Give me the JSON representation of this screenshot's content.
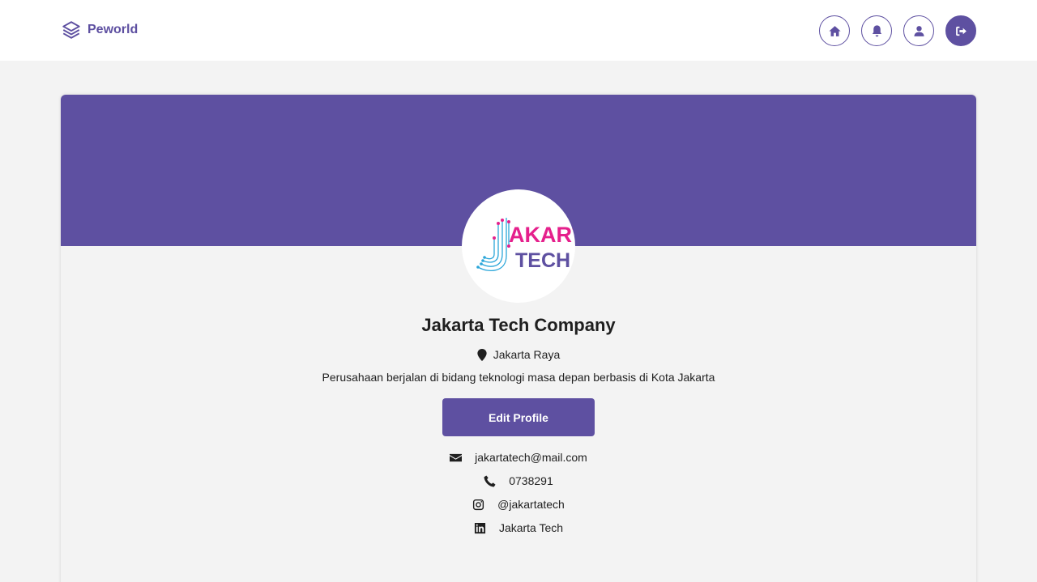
{
  "navbar": {
    "brand": "Peworld",
    "icons": [
      "home-icon",
      "bell-icon",
      "user-icon",
      "logout-icon"
    ]
  },
  "colors": {
    "primary": "#5e50a1",
    "background": "#f3f3f3",
    "logo_pink": "#e5208c",
    "logo_purple": "#5e50a1",
    "logo_cyan": "#2ba6d9"
  },
  "profile": {
    "logo_text_top": "AKARTA",
    "logo_text_bottom": "TECH",
    "name": "Jakarta Tech Company",
    "location": "Jakarta Raya",
    "description": "Perusahaan berjalan di bidang teknologi masa depan berbasis di Kota Jakarta",
    "edit_label": "Edit Profile"
  },
  "contacts": {
    "email": "jakartatech@mail.com",
    "phone": "0738291",
    "instagram": "@jakartatech",
    "linkedin": "Jakarta Tech"
  }
}
